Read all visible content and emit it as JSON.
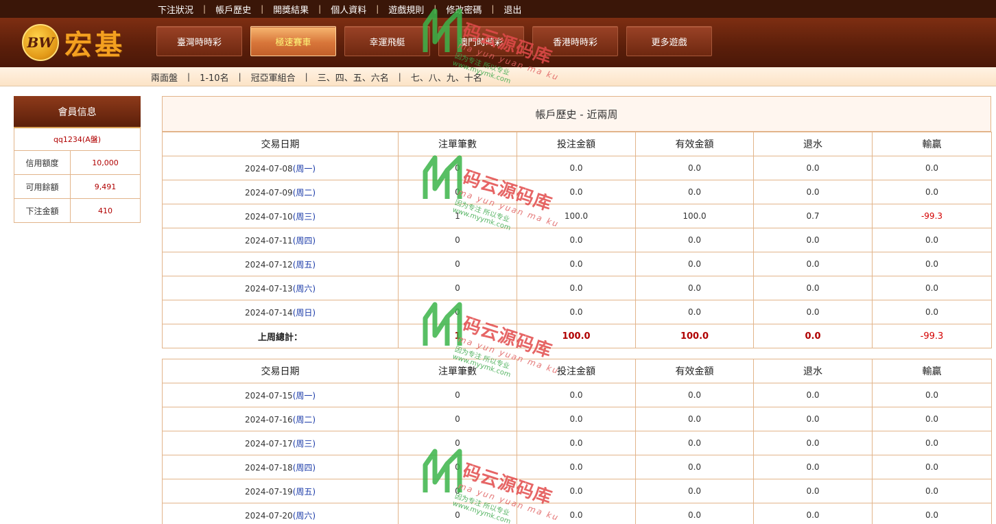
{
  "top_links": [
    "下注狀況",
    "帳戶歷史",
    "開獎結果",
    "個人資料",
    "遊戲規則",
    "修改密碼",
    "退出"
  ],
  "logo": {
    "badge": "BW",
    "name": "宏基"
  },
  "game_tabs": [
    {
      "label": "臺灣時時彩",
      "active": false
    },
    {
      "label": "極速賽車",
      "active": true
    },
    {
      "label": "幸運飛艇",
      "active": false
    },
    {
      "label": "澳門時時彩",
      "active": false
    },
    {
      "label": "香港時時彩",
      "active": false
    },
    {
      "label": "更多遊戲",
      "active": false
    }
  ],
  "subnav": [
    "兩面盤",
    "1-10名",
    "冠亞軍組合",
    "三、四、五、六名",
    "七、八、九、十名"
  ],
  "member": {
    "title": "會員信息",
    "user": "qq1234(A盤)",
    "rows": [
      {
        "key": "信用額度",
        "value": "10,000"
      },
      {
        "key": "可用餘額",
        "value": "9,491"
      },
      {
        "key": "下注金額",
        "value": "410"
      }
    ]
  },
  "history": {
    "title": "帳戶歷史 - 近兩周",
    "columns": [
      "交易日期",
      "注單筆數",
      "投注金額",
      "有效金額",
      "退水",
      "輸贏"
    ],
    "week1": [
      {
        "date": "2024-07-08",
        "weekday": "(周一)",
        "count": "0",
        "bet": "0.0",
        "valid": "0.0",
        "rebate": "0.0",
        "win": "0.0"
      },
      {
        "date": "2024-07-09",
        "weekday": "(周二)",
        "count": "0",
        "bet": "0.0",
        "valid": "0.0",
        "rebate": "0.0",
        "win": "0.0"
      },
      {
        "date": "2024-07-10",
        "weekday": "(周三)",
        "count": "1",
        "bet": "100.0",
        "valid": "100.0",
        "rebate": "0.7",
        "win": "-99.3"
      },
      {
        "date": "2024-07-11",
        "weekday": "(周四)",
        "count": "0",
        "bet": "0.0",
        "valid": "0.0",
        "rebate": "0.0",
        "win": "0.0"
      },
      {
        "date": "2024-07-12",
        "weekday": "(周五)",
        "count": "0",
        "bet": "0.0",
        "valid": "0.0",
        "rebate": "0.0",
        "win": "0.0"
      },
      {
        "date": "2024-07-13",
        "weekday": "(周六)",
        "count": "0",
        "bet": "0.0",
        "valid": "0.0",
        "rebate": "0.0",
        "win": "0.0"
      },
      {
        "date": "2024-07-14",
        "weekday": "(周日)",
        "count": "0",
        "bet": "0.0",
        "valid": "0.0",
        "rebate": "0.0",
        "win": "0.0"
      }
    ],
    "week1_total": {
      "label": "上周總計：",
      "count": "1",
      "bet": "100.0",
      "valid": "100.0",
      "rebate": "0.0",
      "win": "-99.3"
    },
    "week2": [
      {
        "date": "2024-07-15",
        "weekday": "(周一)",
        "count": "0",
        "bet": "0.0",
        "valid": "0.0",
        "rebate": "0.0",
        "win": "0.0"
      },
      {
        "date": "2024-07-16",
        "weekday": "(周二)",
        "count": "0",
        "bet": "0.0",
        "valid": "0.0",
        "rebate": "0.0",
        "win": "0.0"
      },
      {
        "date": "2024-07-17",
        "weekday": "(周三)",
        "count": "0",
        "bet": "0.0",
        "valid": "0.0",
        "rebate": "0.0",
        "win": "0.0"
      },
      {
        "date": "2024-07-18",
        "weekday": "(周四)",
        "count": "0",
        "bet": "0.0",
        "valid": "0.0",
        "rebate": "0.0",
        "win": "0.0"
      },
      {
        "date": "2024-07-19",
        "weekday": "(周五)",
        "count": "0",
        "bet": "0.0",
        "valid": "0.0",
        "rebate": "0.0",
        "win": "0.0"
      },
      {
        "date": "2024-07-20",
        "weekday": "(周六)",
        "count": "0",
        "bet": "0.0",
        "valid": "0.0",
        "rebate": "0.0",
        "win": "0.0"
      }
    ]
  },
  "watermark": {
    "main": "码云源码库",
    "pinyin": "ma yun yuan ma ku",
    "slogan": "因为专注 所以专业",
    "site": "www.myymk.com"
  },
  "colors": {
    "header_dark": "#3a1608",
    "active_tab": "#d8763a",
    "border": "#e2b48a",
    "negative": "#d40000",
    "weekday_link": "#1a3aa8"
  }
}
